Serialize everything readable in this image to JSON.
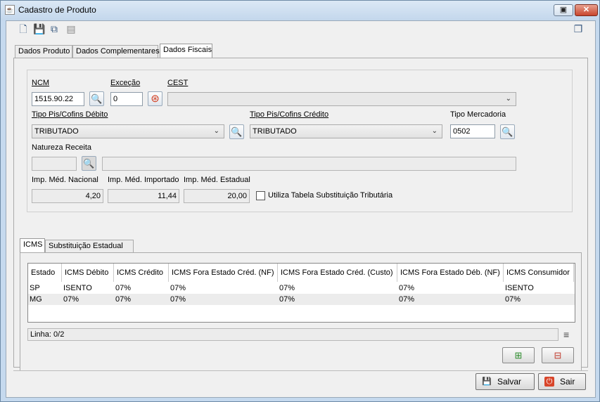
{
  "window": {
    "title": "Cadastro de Produto",
    "restore_icon": "restore-icon",
    "close_icon": "close-icon"
  },
  "toolbar": {
    "icons": [
      "new-document-icon",
      "save-icon",
      "copy-icon",
      "notes-icon"
    ],
    "right_icon": "window-cascade-icon"
  },
  "main_tabs": [
    {
      "label": "Dados Produto",
      "active": false
    },
    {
      "label": "Dados Complementares",
      "active": false
    },
    {
      "label": "Dados Fiscais",
      "active": true
    }
  ],
  "fiscal": {
    "ncm": {
      "label": "NCM",
      "value": "1515.90.22"
    },
    "excecao": {
      "label": "Exceção",
      "value": "0"
    },
    "cest": {
      "label": "CEST",
      "value": ""
    },
    "pis_debito": {
      "label": "Tipo Pis/Cofins Débito",
      "value": "TRIBUTADO"
    },
    "pis_credito": {
      "label": "Tipo Pis/Cofins Crédito",
      "value": "TRIBUTADO"
    },
    "tipo_mercadoria": {
      "label": "Tipo Mercadoria",
      "value": "0502"
    },
    "natureza_receita": {
      "label": "Natureza Receita",
      "code": "",
      "description": ""
    },
    "imp_nacional": {
      "label": "Imp. Méd. Nacional",
      "value": "4,20"
    },
    "imp_importado": {
      "label": "Imp. Méd. Importado",
      "value": "11,44"
    },
    "imp_estadual": {
      "label": "Imp. Méd. Estadual",
      "value": "20,00"
    },
    "substituicao": {
      "label": "Utiliza Tabela Substituição Tributária",
      "checked": false
    }
  },
  "sub_tabs": [
    {
      "label": "ICMS",
      "active": true
    },
    {
      "label": "Substituição Estadual",
      "active": false
    }
  ],
  "icms_table": {
    "columns": [
      "Estado",
      "ICMS Débito",
      "ICMS Crédito",
      "ICMS Fora Estado Créd. (NF)",
      "ICMS Fora Estado Créd. (Custo)",
      "ICMS Fora Estado Déb. (NF)",
      "ICMS Consumidor"
    ],
    "rows": [
      [
        "SP",
        "ISENTO",
        "07%",
        "07%",
        "07%",
        "07%",
        "ISENTO"
      ],
      [
        "MG",
        "07%",
        "07%",
        "07%",
        "07%",
        "07%",
        "07%"
      ]
    ],
    "status": "Linha: 0/2",
    "menu_icon": "hamburger-menu-icon",
    "add_row_icon": "add-row-icon",
    "remove_row_icon": "remove-row-icon"
  },
  "footer": {
    "save_label": "Salvar",
    "exit_label": "Sair"
  }
}
